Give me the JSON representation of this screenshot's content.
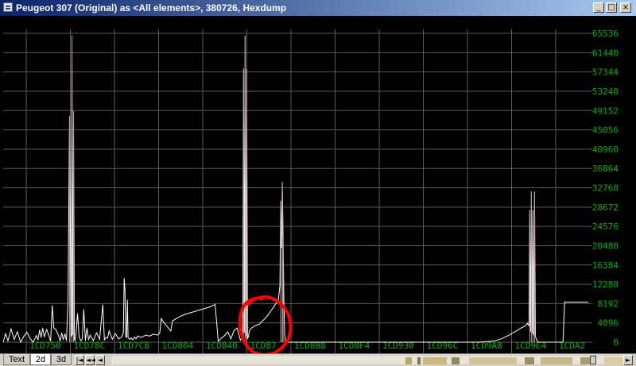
{
  "window": {
    "title": "Peugeot 307 (Original) as <All elements>, 380726, Hexdump",
    "buttons": {
      "minimize": "_",
      "maximize": "□",
      "close": "×"
    }
  },
  "chart_data": {
    "type": "line",
    "ylim": [
      0,
      65536
    ],
    "y_ticks": [
      "0",
      "4096",
      "8192",
      "12288",
      "16384",
      "20480",
      "24576",
      "28672",
      "32768",
      "36864",
      "40960",
      "45056",
      "49152",
      "53248",
      "57344",
      "61440",
      "65536"
    ],
    "x_ticks": [
      "1CD750",
      "1CD78C",
      "1CD7C8",
      "1CD804",
      "1CD840",
      "1CD87",
      "1CD8B8",
      "1CD8F4",
      "1CD930",
      "1CD96C",
      "1CD9A8",
      "1CD9E4",
      "1CDA2"
    ],
    "grid": true,
    "colors": {
      "background": "#000000",
      "grid": "#5a5a5a",
      "line": "#ffffff",
      "spike": "#b89a9a",
      "tick_text": "#00b000",
      "annotation": "#ff0000"
    },
    "annotation": "red hand-drawn circle around the rising ramp near 1CD87x",
    "series": [
      {
        "x": [
          0,
          3,
          6,
          10,
          14,
          18,
          22,
          26,
          30,
          34,
          38,
          42,
          44,
          46,
          48,
          50,
          52,
          55,
          58,
          60,
          62,
          64,
          67,
          70,
          72,
          74,
          76,
          78,
          80,
          82,
          84,
          86,
          87,
          88,
          89,
          90,
          91,
          92,
          94,
          96,
          98,
          100,
          102,
          104,
          106,
          108,
          110,
          114,
          118,
          122,
          126,
          128,
          130,
          132,
          134,
          138,
          142,
          146,
          150,
          152,
          153,
          154,
          155,
          156,
          157,
          158,
          160,
          162,
          164,
          166,
          168,
          170,
          175,
          180,
          185,
          190,
          195,
          198,
          200,
          203,
          206,
          209,
          212,
          214,
          216,
          218,
          220,
          222,
          224,
          230,
          240,
          250,
          260,
          268,
          272,
          276,
          280,
          284,
          288,
          292,
          296,
          300,
          303,
          304,
          305,
          306,
          307,
          308,
          309,
          310,
          311,
          312,
          314,
          316,
          318,
          320,
          322,
          324,
          326,
          328,
          330,
          332,
          334,
          336,
          338,
          340,
          342,
          344,
          346,
          348,
          350,
          351,
          352,
          353,
          354,
          355,
          356,
          357,
          360,
          380,
          400,
          420,
          440,
          460,
          480,
          500,
          520,
          540,
          560,
          580,
          600,
          620,
          630,
          640,
          650,
          655,
          660,
          663,
          665,
          666,
          667,
          668,
          669,
          670,
          671,
          672,
          673,
          674,
          676,
          680,
          690,
          700,
          703,
          706,
          708,
          710,
          720,
          730,
          740
        ],
        "y": [
          0,
          1800,
          300,
          2800,
          600,
          2200,
          0,
          1200,
          2100,
          800,
          0,
          1400,
          500,
          2600,
          1000,
          3000,
          1100,
          2700,
          1300,
          200,
          7800,
          3000,
          2600,
          1400,
          200,
          2000,
          500,
          1800,
          300,
          9000,
          48000,
          1200,
          65000,
          1500,
          49000,
          800,
          200,
          1600,
          6100,
          1200,
          300,
          700,
          7000,
          300,
          3000,
          500,
          1500,
          300,
          2000,
          600,
          8000,
          500,
          1000,
          900,
          2400,
          600,
          1800,
          700,
          1100,
          2000,
          13600,
          11000,
          1200,
          1000,
          9000,
          1000,
          600,
          900,
          500,
          1100,
          700,
          1300,
          1000,
          1500,
          1300,
          1700,
          1500,
          1900,
          5000,
          4200,
          3600,
          3000,
          2400,
          4500,
          4700,
          4900,
          5100,
          5300,
          5500,
          5900,
          6400,
          6900,
          7400,
          8000,
          200,
          900,
          1400,
          2200,
          700,
          2500,
          3000,
          400,
          1000,
          58000,
          2000,
          65000,
          1200,
          58000,
          800,
          1100,
          2000,
          2600,
          3000,
          3200,
          3400,
          3600,
          3700,
          3800,
          4200,
          4500,
          4800,
          5200,
          5600,
          6000,
          6500,
          7000,
          7400,
          8000,
          8500,
          9000,
          12000,
          30000,
          20000,
          34000,
          22000,
          8500,
          1500,
          200,
          0,
          0,
          0,
          0,
          0,
          0,
          0,
          0,
          0,
          0,
          0,
          0,
          0,
          200,
          700,
          1500,
          2500,
          3000,
          3400,
          4000,
          3500,
          28000,
          2200,
          32000,
          1800,
          28000,
          1500,
          32000,
          1200,
          800,
          0,
          0,
          0,
          0,
          0,
          0,
          0,
          8500,
          8500,
          8500,
          8500
        ]
      }
    ]
  },
  "bottom": {
    "tabs": [
      "Text",
      "2d",
      "3d"
    ],
    "active_tab": "2d",
    "nav": [
      "|◄",
      "◄◄",
      "◄",
      "►"
    ]
  }
}
